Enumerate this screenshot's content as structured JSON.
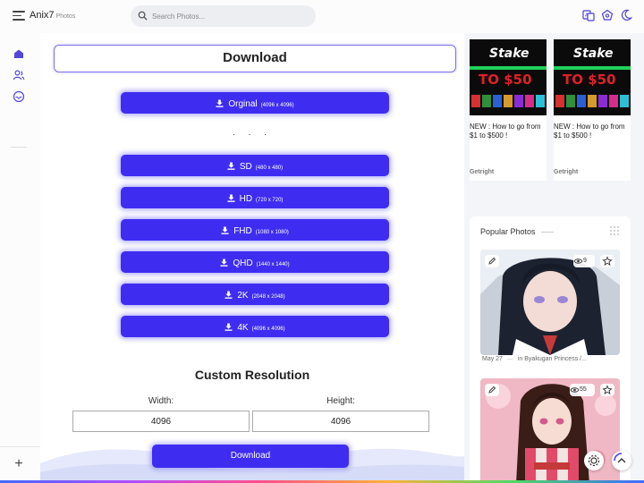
{
  "header": {
    "brand": "Anix7",
    "brand_sub": "Photos",
    "search_placeholder": "Search Photos..."
  },
  "main": {
    "title": "Download",
    "original": {
      "label": "Orginal",
      "res": "(4096 x 4096)"
    },
    "dots": ". . .",
    "downloads": [
      {
        "label": "SD",
        "res": "(480 x 480)"
      },
      {
        "label": "HD",
        "res": "(720 x 720)"
      },
      {
        "label": "FHD",
        "res": "(1080 x 1080)"
      },
      {
        "label": "QHD",
        "res": "(1440 x 1440)"
      },
      {
        "label": "2K",
        "res": "(2048 x 2048)"
      },
      {
        "label": "4K",
        "res": "(4096 x 4096)"
      }
    ],
    "custom": {
      "title": "Custom Resolution",
      "width_label": "Width:",
      "height_label": "Height:",
      "width_value": "4096",
      "height_value": "4096",
      "button": "Download"
    }
  },
  "ads": [
    {
      "brand": "Stake",
      "banner": "TO $50",
      "text": "NEW : How to go from $1 to $500 !",
      "source": "Getright"
    },
    {
      "brand": "Stake",
      "banner": "TO $50",
      "text": "NEW : How to go from $1 to $500 !",
      "source": "Getright"
    }
  ],
  "popular": {
    "title": "Popular Photos",
    "photos": [
      {
        "views": "9",
        "date": "May 27",
        "category": "in Byakugan Princess /..."
      },
      {
        "views": "55"
      }
    ]
  },
  "colors": {
    "accent": "#3e2df0",
    "title_border": "#7b72ee"
  }
}
